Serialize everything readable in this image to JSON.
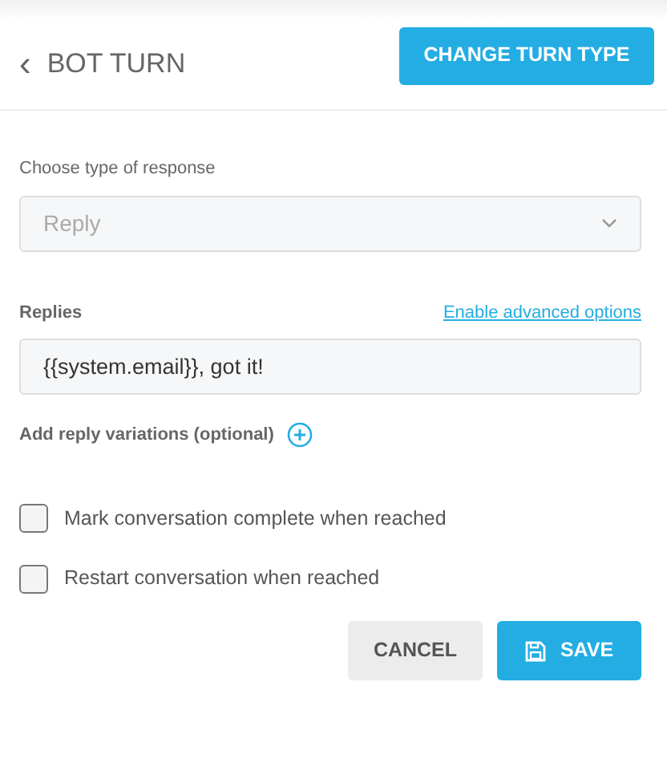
{
  "header": {
    "back_icon": "‹",
    "title": "BOT TURN",
    "action_button": "CHANGE TURN TYPE"
  },
  "response_type": {
    "label": "Choose type of response",
    "value": "Reply",
    "disabled": true
  },
  "replies": {
    "label": "Replies",
    "link": "Enable advanced options",
    "value": "{{system.email}}, got it!",
    "add_variations": "Add reply variations (optional)"
  },
  "options": [
    {
      "label": "Mark conversation complete when reached",
      "checked": false
    },
    {
      "label": "Restart conversation when reached",
      "checked": false
    }
  ],
  "buttons": [
    {
      "kind": "secondary",
      "label": "CANCEL"
    },
    {
      "kind": "primary",
      "label": "SAVE"
    }
  ]
}
